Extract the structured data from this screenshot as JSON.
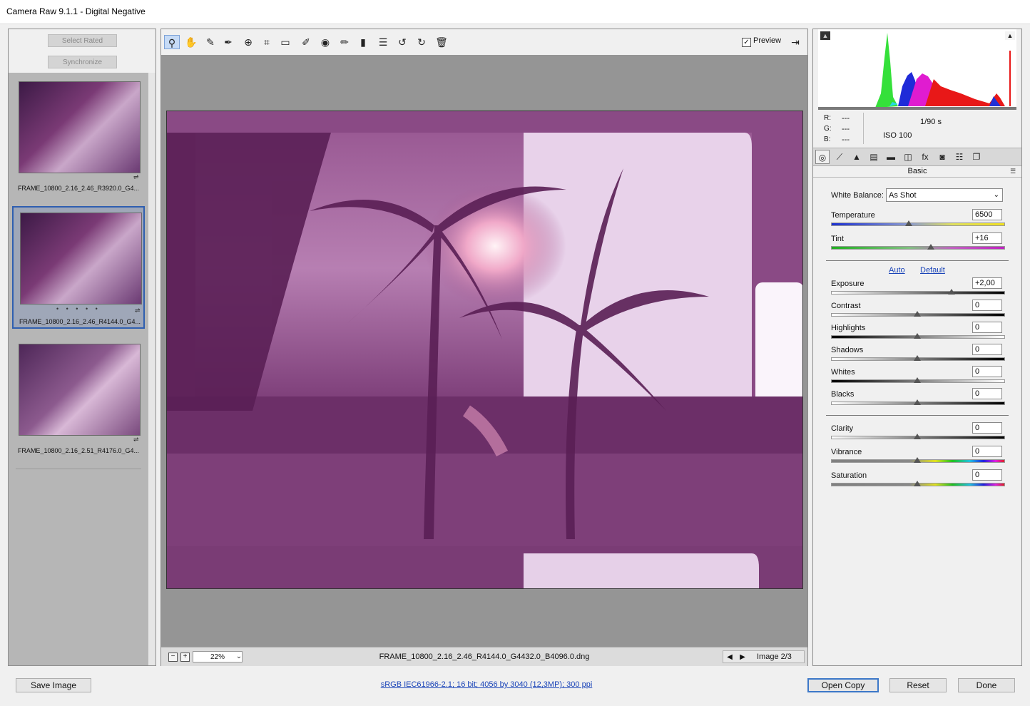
{
  "window": {
    "title": "Camera Raw 9.1.1  -  Digital Negative"
  },
  "filmstrip": {
    "select_rated_label": "Select Rated",
    "synchronize_label": "Synchronize",
    "items": [
      {
        "caption": "FRAME_10800_2.16_2.46_R3920.0_G4...",
        "selected": false
      },
      {
        "caption": "FRAME_10800_2.16_2.46_R4144.0_G4...",
        "selected": true,
        "rating": "• • • • •"
      },
      {
        "caption": "FRAME_10800_2.16_2.51_R4176.0_G4...",
        "selected": false
      }
    ]
  },
  "toolbar": {
    "tools": [
      {
        "name": "zoom-tool",
        "icon": "zoom-icon",
        "glyph": "⚲"
      },
      {
        "name": "hand-tool",
        "icon": "hand-icon",
        "glyph": "✋"
      },
      {
        "name": "white-balance-tool",
        "icon": "eyedropper-icon",
        "glyph": "✎"
      },
      {
        "name": "color-sampler-tool",
        "icon": "color-sampler-icon",
        "glyph": "✒"
      },
      {
        "name": "targeted-adjustment-tool",
        "icon": "target-adjust-icon",
        "glyph": "⊕"
      },
      {
        "name": "crop-tool",
        "icon": "crop-icon",
        "glyph": "⌗"
      },
      {
        "name": "straighten-tool",
        "icon": "straighten-icon",
        "glyph": "▭"
      },
      {
        "name": "spot-removal-tool",
        "icon": "spot-removal-icon",
        "glyph": "✐"
      },
      {
        "name": "red-eye-tool",
        "icon": "red-eye-icon",
        "glyph": "◉"
      },
      {
        "name": "adjustment-brush-tool",
        "icon": "brush-icon",
        "glyph": "✏"
      },
      {
        "name": "graduated-filter-tool",
        "icon": "graduated-filter-icon",
        "glyph": "▮"
      },
      {
        "name": "preferences-tool",
        "icon": "list-icon",
        "glyph": "☰"
      },
      {
        "name": "rotate-left-tool",
        "icon": "rotate-left-icon",
        "glyph": "↺"
      },
      {
        "name": "rotate-right-tool",
        "icon": "rotate-right-icon",
        "glyph": "↻"
      },
      {
        "name": "delete-tool",
        "icon": "trash-icon",
        "glyph": "🗑"
      }
    ],
    "preview_label": "Preview",
    "preview_checked": "✓",
    "fullscreen_glyph": "⇥"
  },
  "status": {
    "zoom_out": "−",
    "zoom_in": "+",
    "zoom_value": "22%",
    "zoom_arrow": "⌄",
    "filename": "FRAME_10800_2.16_2.46_R4144.0_G4432.0_B4096.0.dng",
    "prev_glyph": "◀",
    "next_glyph": "▶",
    "image_count": "Image 2/3"
  },
  "meta": {
    "r_label": "R:",
    "r_value": "---",
    "g_label": "G:",
    "g_value": "---",
    "b_label": "B:",
    "b_value": "---",
    "shutter": "1/90 s",
    "iso": "ISO 100"
  },
  "panel": {
    "tabs": [
      {
        "name": "tab-basic",
        "icon": "basic-icon",
        "glyph": "◎"
      },
      {
        "name": "tab-tone-curve",
        "icon": "tone-curve-icon",
        "glyph": "⟋"
      },
      {
        "name": "tab-detail",
        "icon": "detail-icon",
        "glyph": "▲"
      },
      {
        "name": "tab-hsl",
        "icon": "hsl-icon",
        "glyph": "▤"
      },
      {
        "name": "tab-split-toning",
        "icon": "split-toning-icon",
        "glyph": "▬"
      },
      {
        "name": "tab-lens",
        "icon": "lens-icon",
        "glyph": "◫"
      },
      {
        "name": "tab-effects",
        "icon": "fx-icon",
        "glyph": "fx"
      },
      {
        "name": "tab-camera-calibration",
        "icon": "camera-icon",
        "glyph": "◙"
      },
      {
        "name": "tab-presets",
        "icon": "presets-icon",
        "glyph": "☷"
      },
      {
        "name": "tab-snapshots",
        "icon": "snapshots-icon",
        "glyph": "❐"
      }
    ],
    "title": "Basic",
    "menu_glyph": "☰",
    "white_balance_label": "White Balance:",
    "white_balance_value": "As Shot",
    "auto_label": "Auto",
    "default_label": "Default",
    "sliders": [
      {
        "key": "temperature",
        "label": "Temperature",
        "value": "6500",
        "pos": 0.45,
        "track": "temp"
      },
      {
        "key": "tint",
        "label": "Tint",
        "value": "+16",
        "pos": 0.58,
        "track": "tint"
      },
      {
        "key": "exposure",
        "label": "Exposure",
        "value": "+2,00",
        "pos": 0.7,
        "track": "bw"
      },
      {
        "key": "contrast",
        "label": "Contrast",
        "value": "0",
        "pos": 0.5,
        "track": "bw"
      },
      {
        "key": "highlights",
        "label": "Highlights",
        "value": "0",
        "pos": 0.5,
        "track": "wb"
      },
      {
        "key": "shadows",
        "label": "Shadows",
        "value": "0",
        "pos": 0.5,
        "track": "bw"
      },
      {
        "key": "whites",
        "label": "Whites",
        "value": "0",
        "pos": 0.5,
        "track": "wb"
      },
      {
        "key": "blacks",
        "label": "Blacks",
        "value": "0",
        "pos": 0.5,
        "track": "bw"
      },
      {
        "key": "clarity",
        "label": "Clarity",
        "value": "0",
        "pos": 0.5,
        "track": "bw"
      },
      {
        "key": "vibrance",
        "label": "Vibrance",
        "value": "0",
        "pos": 0.5,
        "track": "rainbow"
      },
      {
        "key": "saturation",
        "label": "Saturation",
        "value": "0",
        "pos": 0.5,
        "track": "rainbow"
      }
    ]
  },
  "bottom": {
    "save_label": "Save Image",
    "info_link": "sRGB IEC61966-2.1; 16 bit; 4056 by 3040 (12,3MP); 300 ppi",
    "open_copy_label": "Open Copy",
    "reset_label": "Reset",
    "done_label": "Done"
  },
  "colors": {
    "accent": "#3c78c8",
    "link": "#1a44b8",
    "photo_tint": "#8b4b86"
  }
}
